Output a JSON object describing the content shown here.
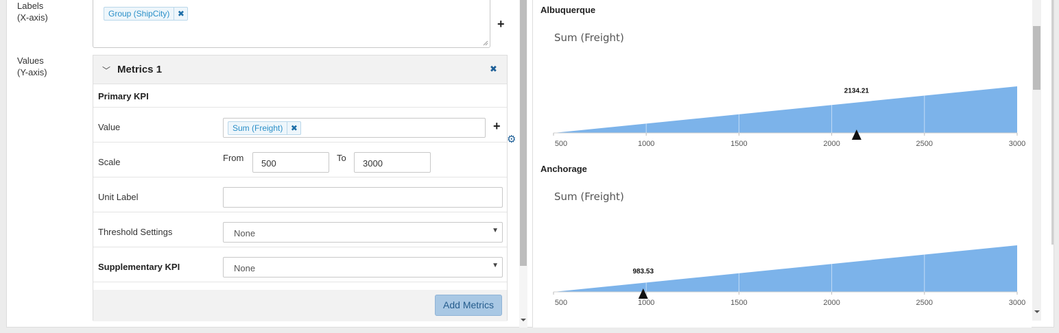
{
  "labels_section": {
    "label": "Labels\n(X-axis)",
    "chip_text": "Group (ShipCity)",
    "remove_symbol": "✖",
    "add_symbol": "+"
  },
  "values_section": {
    "label": "Values\n(Y-axis)"
  },
  "metrics": {
    "title": "Metrics 1",
    "collapse_symbol": "﹀",
    "close_symbol": "✖",
    "primary_kpi": "Primary KPI",
    "value_label": "Value",
    "value_chip": "Sum (Freight)",
    "value_remove": "✖",
    "value_add": "+",
    "gear_icon": "⚙",
    "scale_label": "Scale",
    "from_label": "From",
    "from_value": "500",
    "to_label": "To",
    "to_value": "3000",
    "unit_label": "Unit Label",
    "unit_value": "",
    "threshold_label": "Threshold Settings",
    "threshold_value": "None",
    "supplementary_label": "Supplementary KPI",
    "supplementary_value": "None",
    "add_metrics": "Add Metrics"
  },
  "colors": {
    "fill": "#7cb3ea",
    "accent": "#2a8fc8"
  },
  "charts_caption": {
    "a": "Albuquerque",
    "b": "Anchorage",
    "title": "Sum (Freight)"
  },
  "chart_data": [
    {
      "type": "bullet-wedge",
      "label": "Albuquerque",
      "title": "Sum (Freight)",
      "value": 2134.21,
      "value_label": "2134.21",
      "range": [
        500,
        3000
      ],
      "ticks": [
        "500",
        "1000",
        "1500",
        "2000",
        "2500",
        "3000"
      ]
    },
    {
      "type": "bullet-wedge",
      "label": "Anchorage",
      "title": "Sum (Freight)",
      "value": 983.53,
      "value_label": "983.53",
      "range": [
        500,
        3000
      ],
      "ticks": [
        "500",
        "1000",
        "1500",
        "2000",
        "2500",
        "3000"
      ]
    }
  ]
}
